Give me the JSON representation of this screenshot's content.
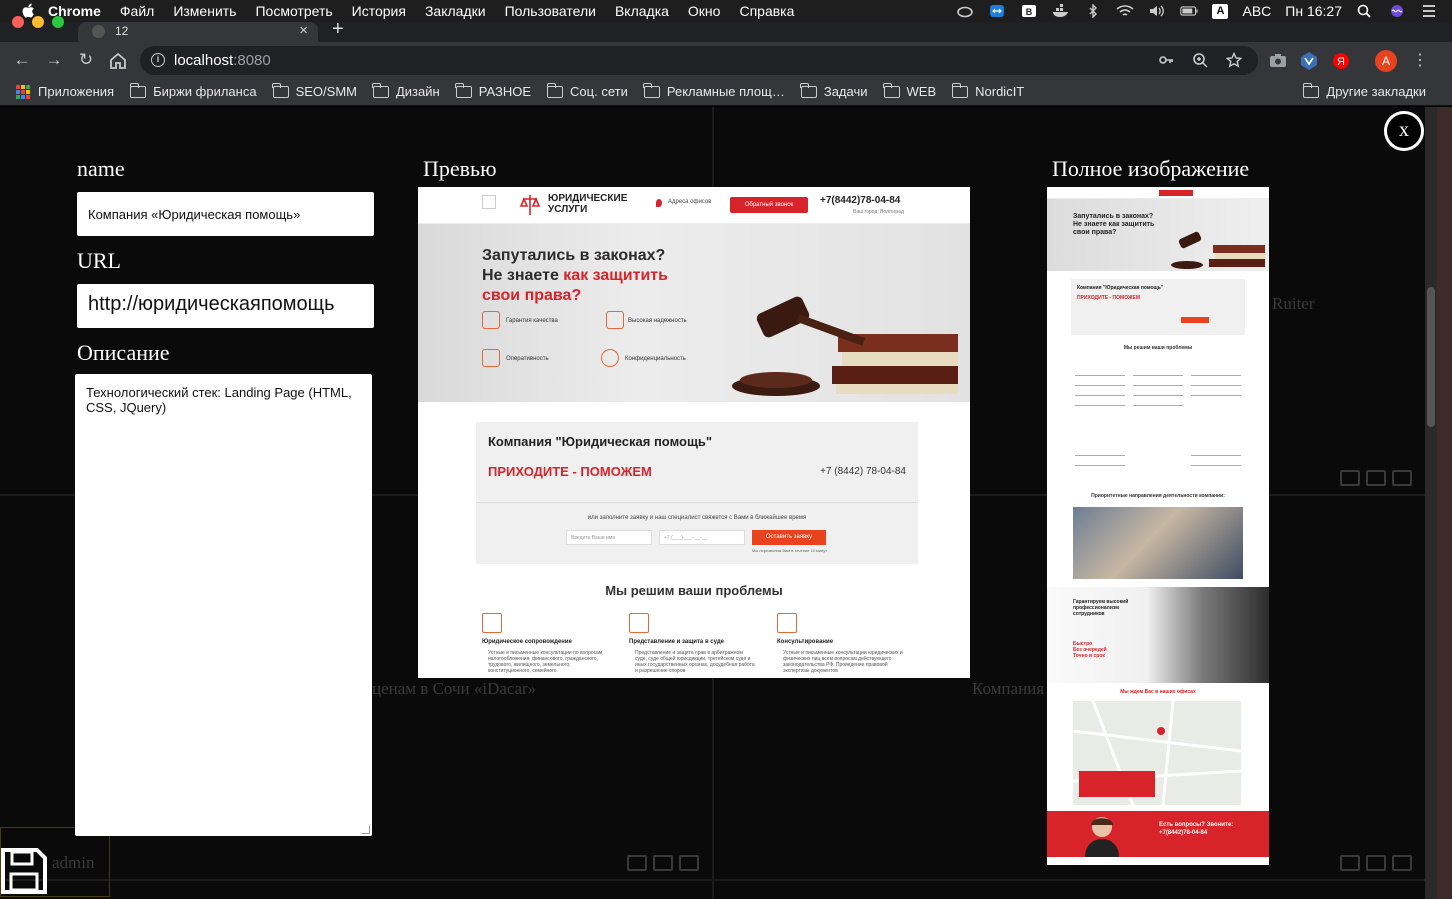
{
  "menubar": {
    "app": "Chrome",
    "items": [
      "Файл",
      "Изменить",
      "Посмотреть",
      "История",
      "Закладки",
      "Пользователи",
      "Вкладка",
      "Окно",
      "Справка"
    ],
    "input_source": "ABC",
    "clock": "Пн 16:27"
  },
  "tab": {
    "title": "12"
  },
  "omnibox": {
    "host": "localhost",
    "port": ":8080"
  },
  "profile": {
    "initial": "А"
  },
  "bookmarks": {
    "apps": "Приложения",
    "folders": [
      "Биржи фриланса",
      "SEO/SMM",
      "Дизайн",
      "РАЗНОЕ",
      "Соц. сети",
      "Рекламные площ…",
      "Задачи",
      "WEB",
      "NordicIT"
    ],
    "other": "Другие закладки"
  },
  "background": {
    "t1": "Ruiter",
    "t2": "ценам в Сочи «iDacar»",
    "t3": "Компания",
    "t4": "admin"
  },
  "modal": {
    "close_label": "x",
    "name_label": "name",
    "name_value": "Компания «Юридическая помощь»",
    "url_label": "URL",
    "url_value": "http://юридическаяпомощь",
    "desc_label": "Описание",
    "desc_value": "Технологический стек: Landing Page (HTML, CSS, JQuery)",
    "preview_label": "Превью",
    "full_label": "Полное изображение"
  },
  "preview": {
    "logo": "ЮРИДИЧЕСКИЕ\nУСЛУГИ",
    "address": "Адреса офисов",
    "callback": "Обратный звонок",
    "phone": "+7(8442)78-04-84",
    "city": "Ваш город: Волгоград",
    "h1a": "Запутались в законах?",
    "h1b": "Не знаете ",
    "h1c": "как защитить",
    "h1d": "свои права?",
    "f1": "Гарантия качества",
    "f2": "Высокая надежность",
    "f3": "Оперативность",
    "f4": "Конфиденциальность",
    "card_title": "Компания \"Юридическая помощь\"",
    "card_sub": "ПРИХОДИТЕ - ПОМОЖЕМ",
    "card_phone": "+7 (8442) 78-04-84",
    "card_note": "или заполните заявку и наш специалист свяжется с Вами в ближайшее время",
    "in_name": "Введите Ваше имя",
    "in_phone": "+7 (___) ___-__-__",
    "btn": "Оставить заявку",
    "small": "Мы перезвоним Вам в течение 10 минут",
    "problems": "Мы решим ваши проблемы",
    "col1_h": "Юридическое сопровождение",
    "col1_t": "Устные и письменные консультации по вопросам налогообложения, финансового, гражданского, трудового, жилищного, земельного, конституционного, семейного",
    "col2_h": "Представление и защита в суде",
    "col2_t": "Представление и защита прав в арбитражном суде, суде общей юрисдикции, третейском суде и иных государственных органах, досудебная работа и разрешение споров",
    "col3_h": "Консультирование",
    "col3_t": "Устные и письменные консультации юридических и физических лиц всем вопросам действующего законодательства РФ. Проведение правовой экспертизы документов"
  },
  "full": {
    "hero": "Запутались в законах?\nНе знаете как защитить\nсвои права?",
    "card": "Компания \"Юридическая помощь\"",
    "card_sub": "ПРИХОДИТЕ - ПОМОЖЕМ",
    "sec1": "Мы решим ваши проблемы",
    "sec2": "Приоритетные направления деятельности компании:",
    "hand1": "Гарантируем высокий профессионализм сотрудников",
    "hand2": "Быстро\nБез очередей\nТочно в срок",
    "sec3": "Мы ждем Вас в наших офисах",
    "cta": "Есть вопросы? Звоните:\n+7(8442)78-04-84"
  }
}
